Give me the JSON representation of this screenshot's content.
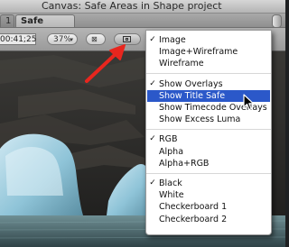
{
  "window": {
    "title": "Canvas: Safe Areas in Shape project"
  },
  "tabs": [
    {
      "label": "1"
    },
    {
      "label": "Safe Areas"
    }
  ],
  "toolbar": {
    "timecode": "00:41;25",
    "zoom_value": "37%"
  },
  "icons": {
    "check": "✓",
    "popup_arrow": "▾",
    "view_mode": "⊠"
  },
  "view_menu": {
    "groups": [
      [
        {
          "label": "Image",
          "checked": true
        },
        {
          "label": "Image+Wireframe",
          "checked": false
        },
        {
          "label": "Wireframe",
          "checked": false
        }
      ],
      [
        {
          "label": "Show Overlays",
          "checked": true
        },
        {
          "label": "Show Title Safe",
          "checked": false,
          "highlighted": true
        },
        {
          "label": "Show Timecode Overlays",
          "checked": false
        },
        {
          "label": "Show Excess Luma",
          "checked": false
        }
      ],
      [
        {
          "label": "RGB",
          "checked": true
        },
        {
          "label": "Alpha",
          "checked": false
        },
        {
          "label": "Alpha+RGB",
          "checked": false
        }
      ],
      [
        {
          "label": "Black",
          "checked": true
        },
        {
          "label": "White",
          "checked": false
        },
        {
          "label": "Checkerboard 1",
          "checked": false
        },
        {
          "label": "Checkerboard 2",
          "checked": false
        }
      ]
    ]
  },
  "colors": {
    "menu_highlight": "#2b58c9",
    "annotation_arrow": "#e8261e"
  }
}
